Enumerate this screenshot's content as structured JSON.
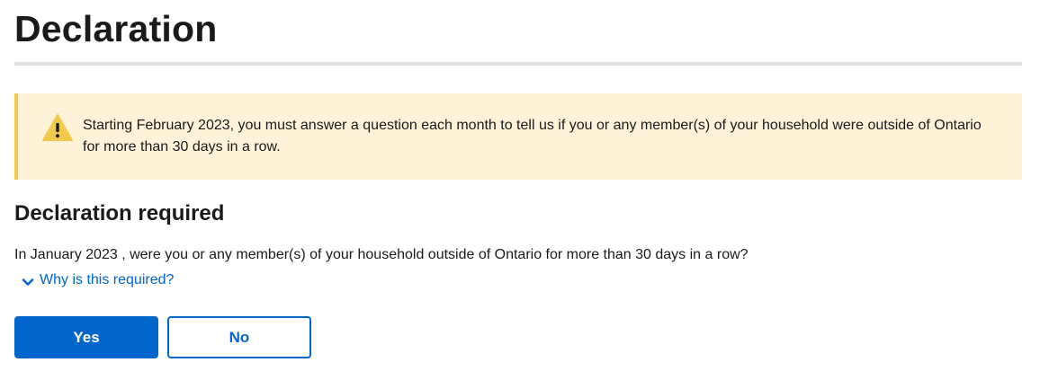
{
  "page": {
    "title": "Declaration"
  },
  "warning": {
    "icon": "warning-triangle-icon",
    "text": "Starting February 2023, you must answer a question each month to tell us if you or any member(s) of your household were outside of Ontario for more than 30 days in a row.",
    "background_color": "#fef3d8",
    "accent_color": "#f2c94c"
  },
  "declaration": {
    "heading": "Declaration required",
    "question": "In January 2023 , were you or any member(s) of your household outside of Ontario for more than 30 days in a row?",
    "why_link": {
      "icon": "chevron-down-icon",
      "label": "Why is this required?"
    }
  },
  "buttons": {
    "yes_label": "Yes",
    "no_label": "No",
    "primary_color": "#0066cc"
  }
}
